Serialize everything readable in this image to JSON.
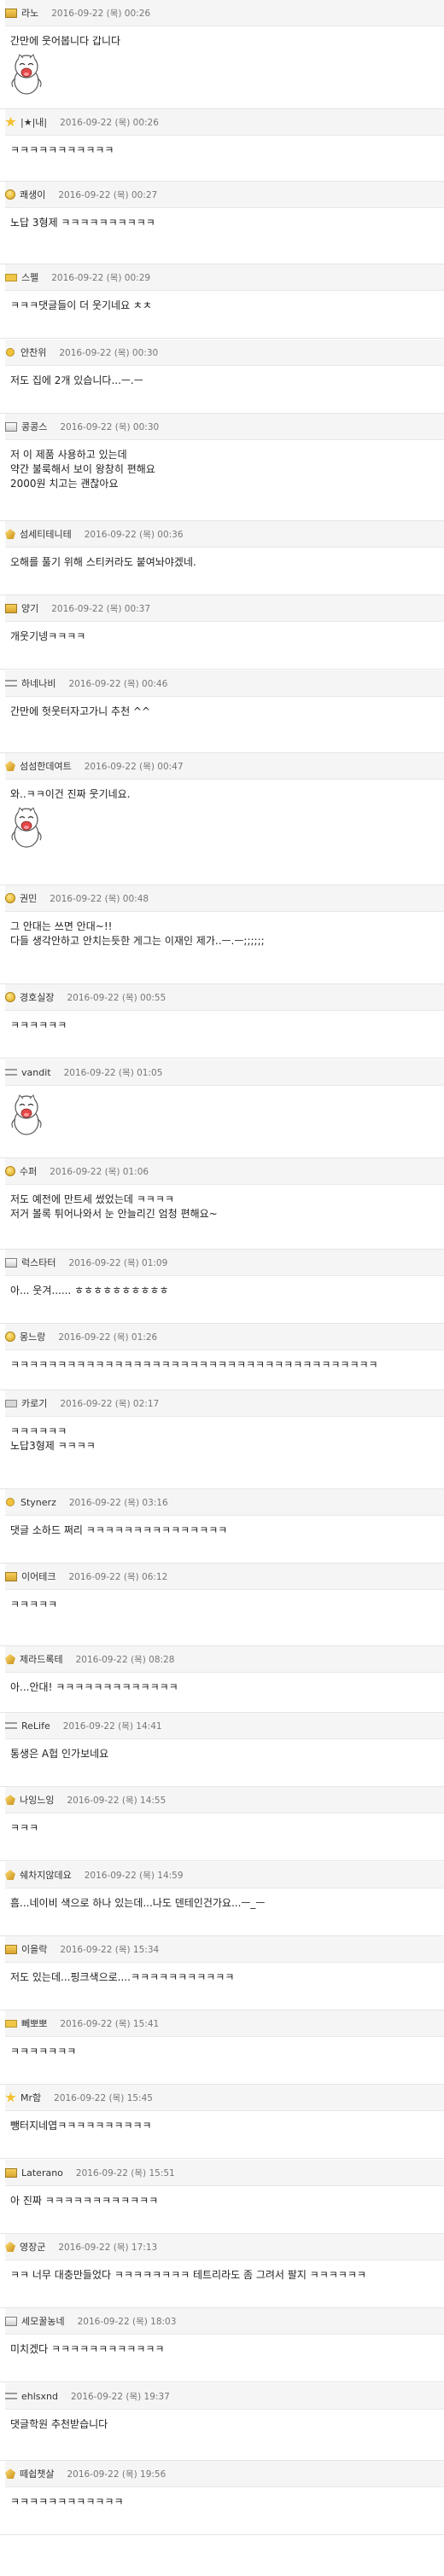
{
  "comments": [
    {
      "nick": "라노",
      "date": "2016-09-22 (목) 00:26",
      "text": "간만에 웃어봅니다 갑니다",
      "icon": "book-icon",
      "sticker": true
    },
    {
      "nick": "|★|내|",
      "date": "2016-09-22 (목) 00:26",
      "text": "ㅋㅋㅋㅋㅋㅋㅋㅋㅋㅋㅋ",
      "icon": "star-icon",
      "sticker": false
    },
    {
      "nick": "쾌생이",
      "date": "2016-09-22 (목) 00:27",
      "text": "노답 3형제 ㅋㅋㅋㅋㅋㅋㅋㅋㅋㅋ",
      "icon": "coin-icon",
      "sticker": false
    },
    {
      "nick": "스펠",
      "date": "2016-09-22 (목) 00:29",
      "text": "ㅋㅋㅋ댓글들이 더 웃기네요 ㅊㅊ",
      "icon": "bar-icon",
      "sticker": false
    },
    {
      "nick": "얀찬위",
      "date": "2016-09-22 (목) 00:30",
      "text": "저도 집에 2개 있습니다...ㅡ.ㅡ",
      "icon": "dot-icon",
      "sticker": false
    },
    {
      "nick": "콩콩스",
      "date": "2016-09-22 (목) 00:30",
      "text": "저 이 제품 사용하고 있는데\n약간 불룩해서 보이 왕창히 편해요\n2000원 치고는 괜찮아요",
      "icon": "box-icon",
      "sticker": false
    },
    {
      "nick": "섬세티테니테",
      "date": "2016-09-22 (목) 00:36",
      "text": "오해를 풀기 위해 스티커라도 붙여놔야겠네.",
      "icon": "gem-icon",
      "sticker": false
    },
    {
      "nick": "양기",
      "date": "2016-09-22 (목) 00:37",
      "text": "개웃기넹ㅋㅋㅋㅋ",
      "icon": "book-icon",
      "sticker": false
    },
    {
      "nick": "하네나비",
      "date": "2016-09-22 (목) 00:46",
      "text": "간만에 헛웃터자고가니 추천 ^^",
      "icon": "line-icon",
      "sticker": false
    },
    {
      "nick": "섬섬한데여트",
      "date": "2016-09-22 (목) 00:47",
      "text": "와..ㅋㅋ이건 진짜 웃기네요.",
      "icon": "gem-icon",
      "sticker": true
    },
    {
      "nick": "권민",
      "date": "2016-09-22 (목) 00:48",
      "text": "그 안대는 쓰면 안대~!!\n다들 생각안하고 안치는듯한 게그는 이재인 제가..ㅡ.ㅡ;;;;;;",
      "icon": "coin-icon",
      "sticker": false
    },
    {
      "nick": "경호실장",
      "date": "2016-09-22 (목) 00:55",
      "text": "ㅋㅋㅋㅋㅋㅋ",
      "icon": "coin-icon",
      "sticker": false
    },
    {
      "nick": "vandit",
      "date": "2016-09-22 (목) 01:05",
      "text": "",
      "icon": "line-icon",
      "sticker": true
    },
    {
      "nick": "수퍼",
      "date": "2016-09-22 (목) 01:06",
      "text": "저도 예전에 만트세 썼었는데 ㅋㅋㅋㅋ\n저거 볼록 튀어나와서 눈 안늘리긴 엄청 편해요~",
      "icon": "coin-icon",
      "sticker": false
    },
    {
      "nick": "럭스타터",
      "date": "2016-09-22 (목) 01:09",
      "text": "아... 웃겨...... ㅎㅎㅎㅎㅎㅎㅎㅎㅎㅎ",
      "icon": "box-icon",
      "sticker": false
    },
    {
      "nick": "몽느랑",
      "date": "2016-09-22 (목) 01:26",
      "text": "ㅋㅋㅋㅋㅋㅋㅋㅋㅋㅋㅋㅋㅋㅋㅋㅋㅋㅋㅋㅋㅋㅋㅋㅋㅋㅋㅋㅋㅋㅋㅋㅋㅋㅋㅋㅋㅋㅋㅋ",
      "icon": "coin-icon",
      "sticker": false
    },
    {
      "nick": "카로기",
      "date": "2016-09-22 (목) 02:17",
      "text": "ㅋㅋㅋㅋㅋㅋ\n노답3형제 ㅋㅋㅋㅋ",
      "icon": "bar2-icon",
      "sticker": false
    },
    {
      "nick": "Stynerz",
      "date": "2016-09-22 (목) 03:16",
      "text": "댓글 소하드 쩌리 ㅋㅋㅋㅋㅋㅋㅋㅋㅋㅋㅋㅋㅋㅋㅋ",
      "icon": "dot-icon",
      "sticker": false
    },
    {
      "nick": "이어테크",
      "date": "2016-09-22 (목) 06:12",
      "text": "ㅋㅋㅋㅋㅋ",
      "icon": "book-icon",
      "sticker": false
    },
    {
      "nick": "제라드록테",
      "date": "2016-09-22 (목) 08:28",
      "text": "아...안대! ㅋㅋㅋㅋㅋㅋㅋㅋㅋㅋㅋㅋㅋ",
      "icon": "gem-icon",
      "sticker": false
    },
    {
      "nick": "ReLife",
      "date": "2016-09-22 (목) 14:41",
      "text": "통생은 A헙 인가보네요",
      "icon": "line-icon",
      "sticker": false
    },
    {
      "nick": "나잉느잉",
      "date": "2016-09-22 (목) 14:55",
      "text": "ㅋㅋㅋ",
      "icon": "gem-icon",
      "sticker": false
    },
    {
      "nick": "쉐차지않데요",
      "date": "2016-09-22 (목) 14:59",
      "text": "흠...네이비 색으로 하나 있는데...나도 덴테인건가요...ㅡ_ㅡ",
      "icon": "gem-icon",
      "sticker": false
    },
    {
      "nick": "이을락",
      "date": "2016-09-22 (목) 15:34",
      "text": "저도 있는데...핑크색으로....ㅋㅋㅋㅋㅋㅋㅋㅋㅋㅋㅋ",
      "icon": "book-icon",
      "sticker": false
    },
    {
      "nick": "뻬뽀뽀",
      "date": "2016-09-22 (목) 15:41",
      "text": "ㅋㅋㅋㅋㅋㅋㅋ",
      "icon": "bar-icon",
      "sticker": false
    },
    {
      "nick": "Mr함",
      "date": "2016-09-22 (목) 15:45",
      "text": "뺑터지네엽ㅋㅋㅋㅋㅋㅋㅋㅋㅋㅋ",
      "icon": "star-icon",
      "sticker": false
    },
    {
      "nick": "Laterano",
      "date": "2016-09-22 (목) 15:51",
      "text": "아 진짜 ㅋㅋㅋㅋㅋㅋㅋㅋㅋㅋㅋㅋ",
      "icon": "book-icon",
      "sticker": false
    },
    {
      "nick": "영장군",
      "date": "2016-09-22 (목) 17:13",
      "text": "ㅋㅋ 너무 대충만들었다 ㅋㅋㅋㅋㅋㅋㅋㅋ 테트리라도 좀 그려서 팔지 ㅋㅋㅋㅋㅋㅋ",
      "icon": "gem-icon",
      "sticker": false
    },
    {
      "nick": "세모꿀농네",
      "date": "2016-09-22 (목) 18:03",
      "text": "미치겠다 ㅋㅋㅋㅋㅋㅋㅋㅋㅋㅋㅋㅋ",
      "icon": "box-icon",
      "sticker": false
    },
    {
      "nick": "ehlsxnd",
      "date": "2016-09-22 (목) 19:37",
      "text": "댓글학원 추천받습니다",
      "icon": "line-icon",
      "sticker": false
    },
    {
      "nick": "떼쉽챗살",
      "date": "2016-09-22 (목) 19:56",
      "text": "ㅋㅋㅋㅋㅋㅋㅋㅋㅋㅋㅋㅋ",
      "icon": "gem-icon",
      "sticker": false
    }
  ]
}
